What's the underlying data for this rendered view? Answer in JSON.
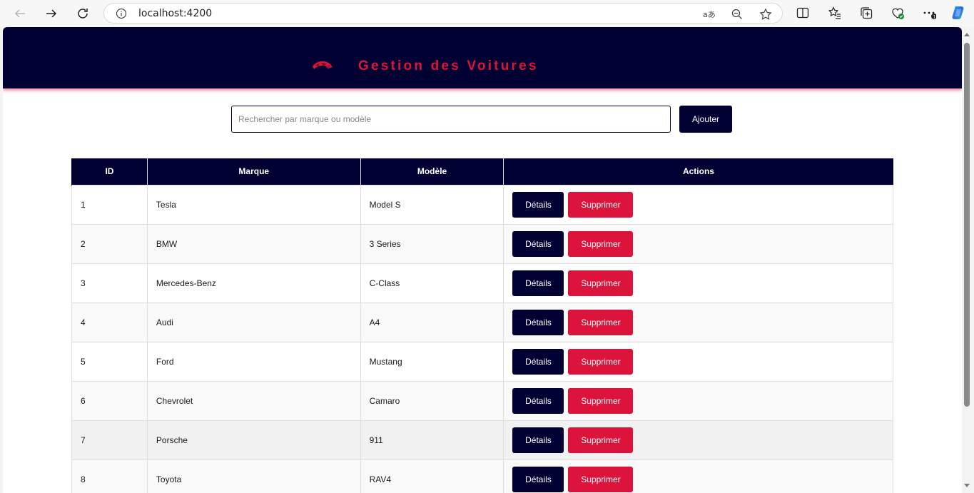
{
  "browser": {
    "url": "localhost:4200"
  },
  "app": {
    "title": "Gestion des Voitures",
    "accent_color": "#dc143c",
    "primary_color": "#000033"
  },
  "search": {
    "placeholder": "Rechercher par marque ou modèle",
    "value": ""
  },
  "toolbar": {
    "add_label": "Ajouter"
  },
  "table": {
    "headers": [
      "ID",
      "Marque",
      "Modèle",
      "Actions"
    ],
    "details_label": "Détails",
    "delete_label": "Supprimer",
    "rows": [
      {
        "id": "1",
        "marque": "Tesla",
        "modele": "Model S"
      },
      {
        "id": "2",
        "marque": "BMW",
        "modele": "3 Series"
      },
      {
        "id": "3",
        "marque": "Mercedes-Benz",
        "modele": "C-Class"
      },
      {
        "id": "4",
        "marque": "Audi",
        "modele": "A4"
      },
      {
        "id": "5",
        "marque": "Ford",
        "modele": "Mustang"
      },
      {
        "id": "6",
        "marque": "Chevrolet",
        "modele": "Camaro"
      },
      {
        "id": "7",
        "marque": "Porsche",
        "modele": "911"
      },
      {
        "id": "8",
        "marque": "Toyota",
        "modele": "RAV4"
      }
    ]
  }
}
